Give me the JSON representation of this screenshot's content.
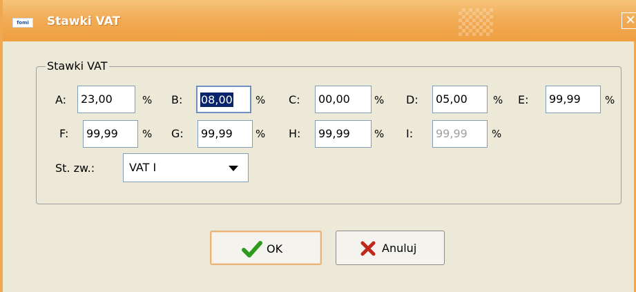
{
  "window": {
    "title": "Stawki VAT",
    "app_icon_text": "fomi",
    "close_glyph": "✕"
  },
  "group": {
    "label": "Stawki VAT"
  },
  "fields": {
    "A": {
      "label": "A:",
      "value": "23,00",
      "unit": "%"
    },
    "B": {
      "label": "B:",
      "value": "08,00",
      "unit": "%"
    },
    "C": {
      "label": "C:",
      "value": "00,00",
      "unit": "%"
    },
    "D": {
      "label": "D:",
      "value": "05,00",
      "unit": "%"
    },
    "E": {
      "label": "E:",
      "value": "99,99",
      "unit": "%"
    },
    "F": {
      "label": "F:",
      "value": "99,99",
      "unit": "%"
    },
    "G": {
      "label": "G:",
      "value": "99,99",
      "unit": "%"
    },
    "H": {
      "label": "H:",
      "value": "99,99",
      "unit": "%"
    },
    "I": {
      "label": "I:",
      "value": "99,99",
      "unit": "%"
    }
  },
  "st_zw": {
    "label": "St. zw.:",
    "selected": "VAT I"
  },
  "buttons": {
    "ok": {
      "label": "OK",
      "icon": "checkmark-icon",
      "color": "#2e9a1e"
    },
    "cancel": {
      "label": "Anuluj",
      "icon": "cross-icon",
      "color": "#c0281c"
    }
  },
  "colors": {
    "titlebar": "#f1ac57",
    "selection": "#0a246a"
  }
}
